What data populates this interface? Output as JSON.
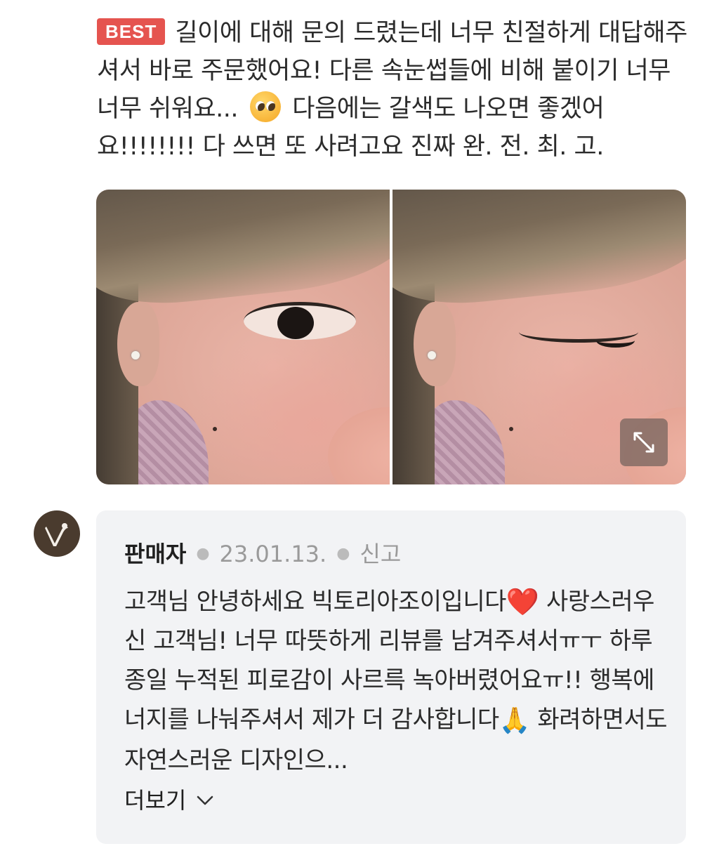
{
  "review": {
    "badge": "BEST",
    "text_part1": "길이에 대해 문의 드렸는데 너무 친절하게 대답해주셔서 바로 주문했어요! 다른 속눈썹들에 비해 붙이기 너무 너무 쉬워요...",
    "emoji": "pleading-face-emoji",
    "text_part2": "다음에는 갈색도 나오면 좋겠어요!!!!!!!! 다 쓰면 또 사려고요 진짜 완. 전. 최. 고."
  },
  "gallery": {
    "photos": [
      "review-photo-eye-open",
      "review-photo-eye-closed"
    ],
    "expand_icon": "expand-arrows-icon"
  },
  "seller_reply": {
    "avatar_icon": "seller-logo-icon",
    "author": "판매자",
    "date": "23.01.13.",
    "report_label": "신고",
    "text_part1": "고객님 안녕하세요 빅토리아조이입니다",
    "heart_emoji": "❤️",
    "text_part2": " 사랑스러우신 고객님! 너무 따뜻하게 리뷰를 남겨주셔서ㅠㅜ 하루종일 누적된 피로감이 사르륵 녹아버렸어요ㅠ!! 행복에너지를 나눠주셔서 제가 더 감사합니다",
    "pray_emoji": "🙏",
    "text_part3": " 화려하면서도 자연스러운 디자인으...",
    "more_label": "더보기",
    "more_icon": "chevron-down-icon"
  }
}
